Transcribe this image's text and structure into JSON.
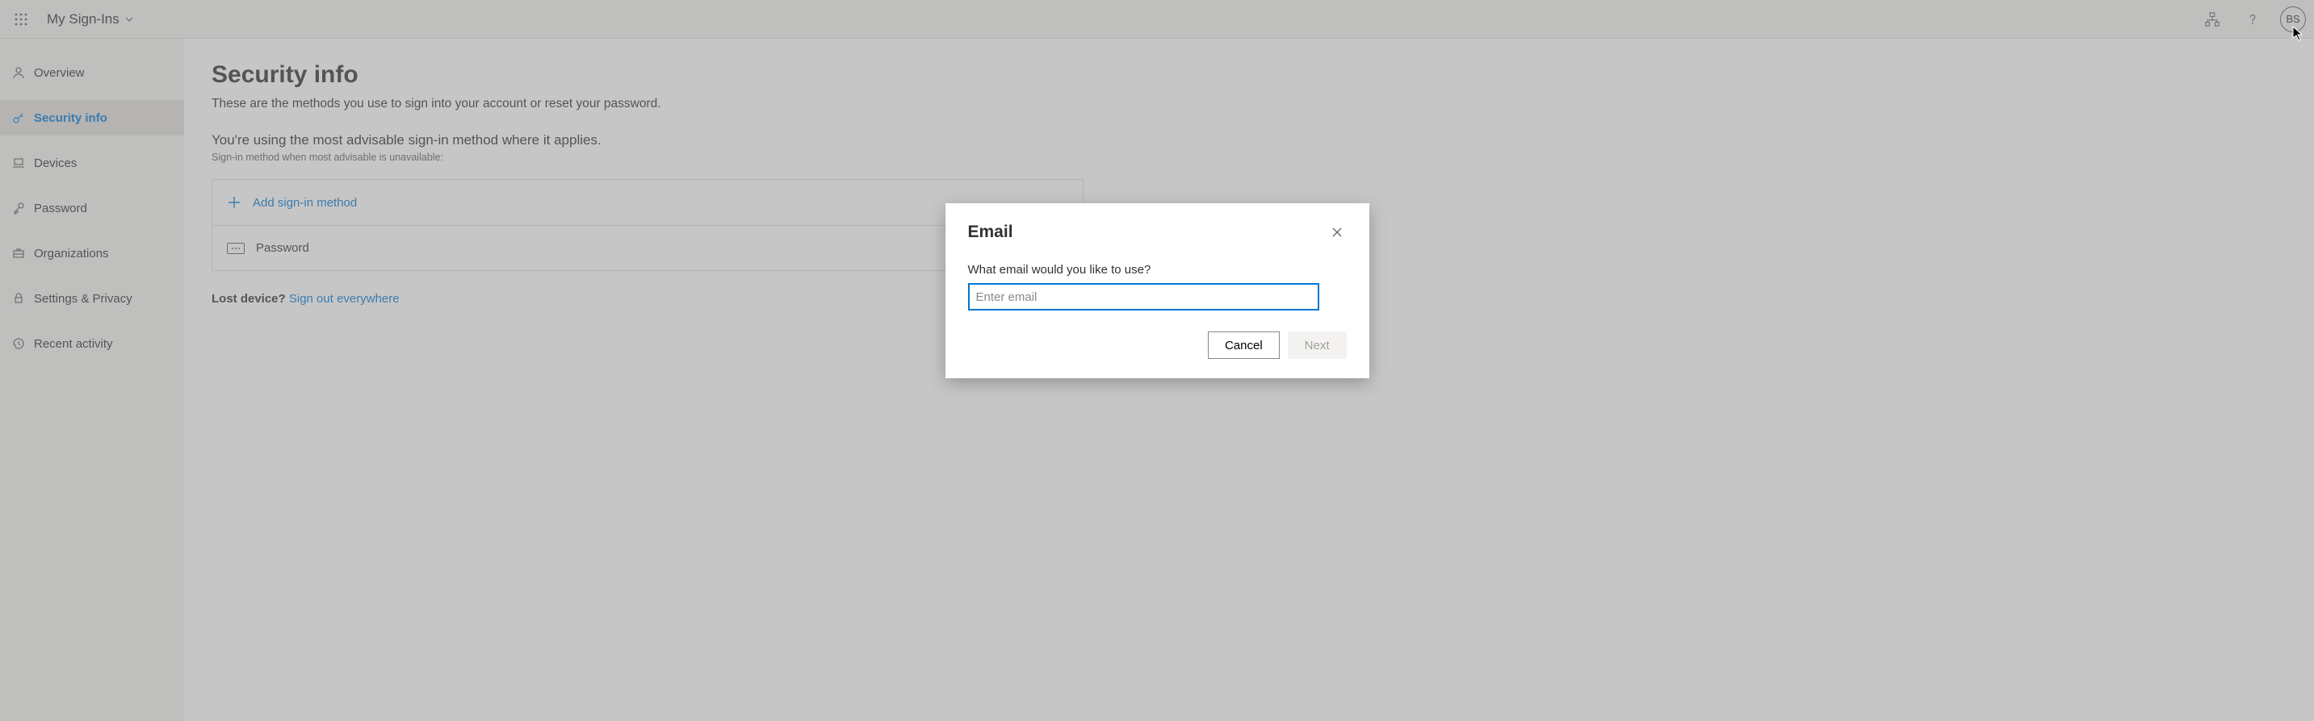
{
  "header": {
    "app_title": "My Sign-Ins",
    "avatar_initials": "BS"
  },
  "sidebar": {
    "items": [
      {
        "label": "Overview"
      },
      {
        "label": "Security info"
      },
      {
        "label": "Devices"
      },
      {
        "label": "Password"
      },
      {
        "label": "Organizations"
      },
      {
        "label": "Settings & Privacy"
      },
      {
        "label": "Recent activity"
      }
    ]
  },
  "page": {
    "title": "Security info",
    "subtitle": "These are the methods you use to sign into your account or reset your password.",
    "advise_title": "You're using the most advisable sign-in method where it applies.",
    "advise_sub": "Sign-in method when most advisable is unavailable:",
    "add_method_label": "Add sign-in method",
    "password_label": "Password",
    "lost_label": "Lost device? ",
    "signout_label": "Sign out everywhere"
  },
  "dialog": {
    "title": "Email",
    "question": "What email would you like to use?",
    "placeholder": "Enter email",
    "cancel": "Cancel",
    "next": "Next"
  }
}
